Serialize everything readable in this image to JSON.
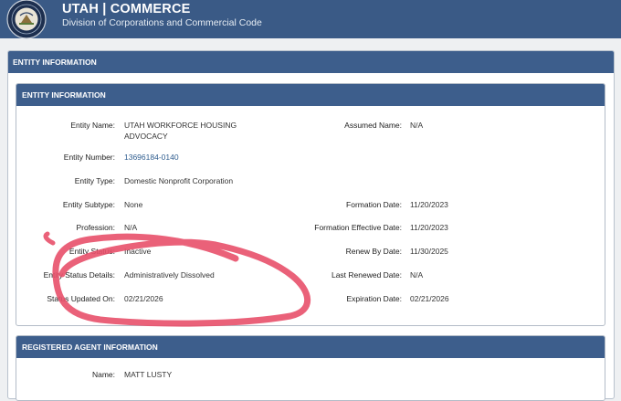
{
  "brand": {
    "title": "UTAH | COMMERCE",
    "subtitle": "Division of Corporations and Commercial Code"
  },
  "outer_header": "ENTITY INFORMATION",
  "entity_panel": {
    "header": "ENTITY INFORMATION",
    "left": [
      {
        "label": "Entity Name:",
        "value": "UTAH WORKFORCE HOUSING ADVOCACY"
      },
      {
        "label": "Entity Number:",
        "value": "13696184-0140"
      },
      {
        "label": "Entity Type:",
        "value": "Domestic Nonprofit Corporation"
      },
      {
        "label": "Entity Subtype:",
        "value": "None"
      },
      {
        "label": "Profession:",
        "value": "N/A"
      },
      {
        "label": "Entity Status:",
        "value": "Inactive"
      },
      {
        "label": "Entity Status Details:",
        "value": "Administratively Dissolved"
      },
      {
        "label": "Status Updated On:",
        "value": "02/21/2026"
      }
    ],
    "right": [
      {
        "label": "Assumed Name:",
        "value": "N/A"
      },
      {
        "label": "Formation Date:",
        "value": "11/20/2023"
      },
      {
        "label": "Formation Effective Date:",
        "value": "11/20/2023"
      },
      {
        "label": "Renew By Date:",
        "value": "11/30/2025"
      },
      {
        "label": "Last Renewed Date:",
        "value": "N/A"
      },
      {
        "label": "Expiration Date:",
        "value": "02/21/2026"
      }
    ]
  },
  "agent_panel": {
    "header": "REGISTERED AGENT INFORMATION",
    "name_label": "Name:",
    "name_value": "MATT LUSTY"
  },
  "colors": {
    "brand_bar": "#3a5a86",
    "panel_header": "#3d5e8c",
    "link": "#2f5d8f",
    "annotation": "#e8506a"
  },
  "icons": {
    "seal": "utah-state-seal-icon"
  }
}
